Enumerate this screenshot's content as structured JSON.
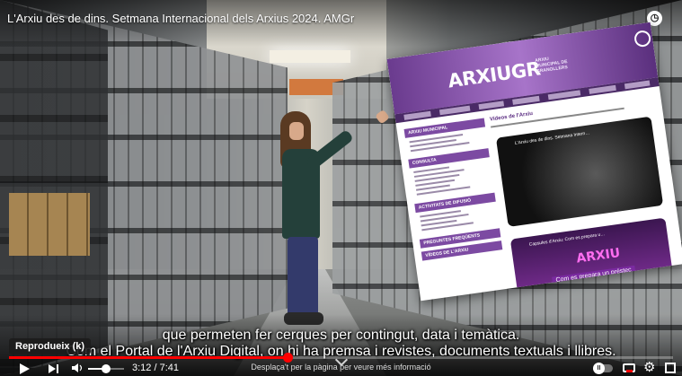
{
  "video": {
    "title": "L'Arxiu des de dins. Setmana Internacional dels Arxius 2024. AMGr",
    "progress": 0.42
  },
  "overlay_page": {
    "logo": "ARXIUGR",
    "logo_sub": "ARXIU MUNICIPAL DE GRANOLLERS",
    "heading": "Vídeos de l'Arxiu",
    "sidebar_sections": [
      "ARXIU MUNICIPAL",
      "CONSULTA",
      "ACTIVITATS DE DIFUSIÓ",
      "PREGUNTES FREQÜENTS",
      "VÍDEOS DE L'ARXIU"
    ],
    "video1_title": "L'Arxiu des de dins. Setmana Intern…",
    "video2_title": "Capsules d'Arxiu: Com es prepara u…",
    "video2_big": "ARXIU",
    "video2_caption": "Com es prepara un préstec"
  },
  "subtitles": {
    "line1": "que permeten fer cerques per contingut, data i temàtica.",
    "line2": "Com el Portal de l'Arxiu Digital, on hi ha premsa i revistes, documents textuals i llibres."
  },
  "controls": {
    "tooltip": "Reprodueix (k)",
    "time_current": "3:12",
    "time_separator": "/",
    "time_total": "7:41",
    "volume_level": 0.5,
    "scroll_hint": "Desplaça't per la pàgina per veure més informació",
    "autoplay_glyph": "II",
    "gear_glyph": "⚙"
  },
  "icons": {
    "play": "play-icon",
    "next": "next-icon",
    "volume": "volume-icon",
    "subtitles": "subtitles-icon",
    "settings": "gear-icon",
    "fullscreen": "fullscreen-icon",
    "watch_later": "clock-icon"
  },
  "colors": {
    "progress": "#ff0000",
    "brand_purple": "#7c4aa2"
  }
}
